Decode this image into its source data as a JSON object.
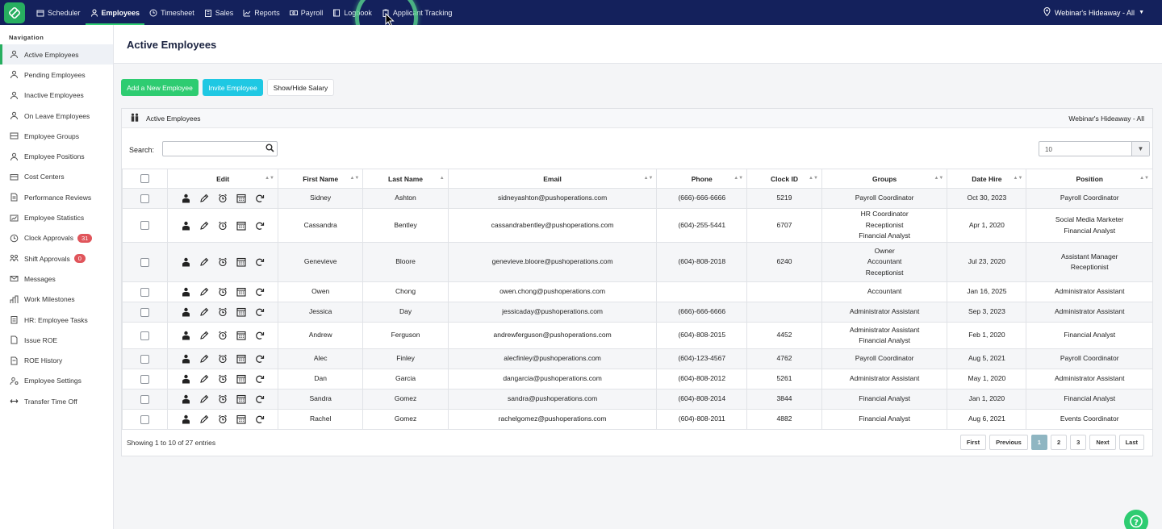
{
  "topnav": {
    "items": [
      {
        "label": "Scheduler",
        "icon": "calendar-icon"
      },
      {
        "label": "Employees",
        "icon": "person-icon",
        "active": true
      },
      {
        "label": "Timesheet",
        "icon": "clock-icon"
      },
      {
        "label": "Sales",
        "icon": "building-icon"
      },
      {
        "label": "Reports",
        "icon": "chart-icon"
      },
      {
        "label": "Payroll",
        "icon": "money-icon"
      },
      {
        "label": "Logbook",
        "icon": "book-icon"
      },
      {
        "label": "Applicant Tracking",
        "icon": "clipboard-icon"
      }
    ],
    "location": "Webinar's Hideaway - All"
  },
  "sidebar": {
    "heading": "Navigation",
    "items": [
      {
        "label": "Active Employees",
        "icon": "person-icon",
        "active": true
      },
      {
        "label": "Pending Employees",
        "icon": "person-pending-icon"
      },
      {
        "label": "Inactive Employees",
        "icon": "person-inactive-icon"
      },
      {
        "label": "On Leave Employees",
        "icon": "person-leave-icon"
      },
      {
        "label": "Employee Groups",
        "icon": "groups-icon"
      },
      {
        "label": "Employee Positions",
        "icon": "positions-icon"
      },
      {
        "label": "Cost Centers",
        "icon": "cost-center-icon"
      },
      {
        "label": "Performance Reviews",
        "icon": "document-icon"
      },
      {
        "label": "Employee Statistics",
        "icon": "statistics-icon"
      },
      {
        "label": "Clock Approvals",
        "icon": "clock-icon",
        "badge": "31"
      },
      {
        "label": "Shift Approvals",
        "icon": "shift-icon",
        "badge": "0"
      },
      {
        "label": "Messages",
        "icon": "mail-icon"
      },
      {
        "label": "Work Milestones",
        "icon": "milestone-icon"
      },
      {
        "label": "HR: Employee Tasks",
        "icon": "tasks-icon"
      },
      {
        "label": "Issue ROE",
        "icon": "roe-icon"
      },
      {
        "label": "ROE History",
        "icon": "history-icon"
      },
      {
        "label": "Employee Settings",
        "icon": "settings-icon"
      },
      {
        "label": "Transfer Time Off",
        "icon": "transfer-icon"
      }
    ]
  },
  "page": {
    "title": "Active Employees",
    "buttons": {
      "add": "Add a New Employee",
      "invite": "Invite Employee",
      "salary": "Show/Hide Salary"
    },
    "panel_title": "Active Employees",
    "panel_location": "Webinar's Hideaway - All",
    "search_label": "Search:",
    "search_value": "",
    "page_length": "10",
    "showing": "Showing 1 to 10 of 27 entries"
  },
  "table": {
    "columns": [
      "Edit",
      "First Name",
      "Last Name",
      "Email",
      "Phone",
      "Clock ID",
      "Groups",
      "Date Hire",
      "Position"
    ],
    "rows": [
      {
        "first": "Sidney",
        "last": "Ashton",
        "email": "sidneyashton@pushoperations.com",
        "phone": "(666)-666-6666",
        "clock": "5219",
        "groups": [
          "Payroll Coordinator"
        ],
        "hire": "Oct 30, 2023",
        "position": [
          "Payroll Coordinator"
        ]
      },
      {
        "first": "Cassandra",
        "last": "Bentley",
        "email": "cassandrabentley@pushoperations.com",
        "phone": "(604)-255-5441",
        "clock": "6707",
        "groups": [
          "HR Coordinator",
          "Receptionist",
          "Financial Analyst"
        ],
        "hire": "Apr 1, 2020",
        "position": [
          "Social Media Marketer",
          "Financial Analyst"
        ]
      },
      {
        "first": "Genevieve",
        "last": "Bloore",
        "email": "genevieve.bloore@pushoperations.com",
        "phone": "(604)-808-2018",
        "clock": "6240",
        "groups": [
          "Owner",
          "Accountant",
          "Receptionist"
        ],
        "hire": "Jul 23, 2020",
        "position": [
          "Assistant Manager",
          "Receptionist"
        ]
      },
      {
        "first": "Owen",
        "last": "Chong",
        "email": "owen.chong@pushoperations.com",
        "phone": "",
        "clock": "",
        "groups": [
          "Accountant"
        ],
        "hire": "Jan 16, 2025",
        "position": [
          "Administrator Assistant"
        ]
      },
      {
        "first": "Jessica",
        "last": "Day",
        "email": "jessicaday@pushoperations.com",
        "phone": "(666)-666-6666",
        "clock": "",
        "groups": [
          "Administrator Assistant"
        ],
        "hire": "Sep 3, 2023",
        "position": [
          "Administrator Assistant"
        ]
      },
      {
        "first": "Andrew",
        "last": "Ferguson",
        "email": "andrewferguson@pushoperations.com",
        "phone": "(604)-808-2015",
        "clock": "4452",
        "groups": [
          "Administrator Assistant",
          "Financial Analyst"
        ],
        "hire": "Feb 1, 2020",
        "position": [
          "Financial Analyst"
        ]
      },
      {
        "first": "Alec",
        "last": "Finley",
        "email": "alecfinley@pushoperations.com",
        "phone": "(604)-123-4567",
        "clock": "4762",
        "groups": [
          "Payroll Coordinator"
        ],
        "hire": "Aug 5, 2021",
        "position": [
          "Payroll Coordinator"
        ]
      },
      {
        "first": "Dan",
        "last": "Garcia",
        "email": "dangarcia@pushoperations.com",
        "phone": "(604)-808-2012",
        "clock": "5261",
        "groups": [
          "Administrator Assistant"
        ],
        "hire": "May 1, 2020",
        "position": [
          "Administrator Assistant"
        ]
      },
      {
        "first": "Sandra",
        "last": "Gomez",
        "email": "sandra@pushoperations.com",
        "phone": "(604)-808-2014",
        "clock": "3844",
        "groups": [
          "Financial Analyst"
        ],
        "hire": "Jan 1, 2020",
        "position": [
          "Financial Analyst"
        ]
      },
      {
        "first": "Rachel",
        "last": "Gomez",
        "email": "rachelgomez@pushoperations.com",
        "phone": "(604)-808-2011",
        "clock": "4882",
        "groups": [
          "Financial Analyst"
        ],
        "hire": "Aug 6, 2021",
        "position": [
          "Events Coordinator"
        ]
      }
    ]
  },
  "pagination": [
    "First",
    "Previous",
    "1",
    "2",
    "3",
    "Next",
    "Last"
  ],
  "pagination_current": "1",
  "colors": {
    "navbar": "#14215c",
    "accent_green": "#2ecc71",
    "accent_cyan": "#1fc8e3",
    "badge_red": "#e0555b"
  }
}
